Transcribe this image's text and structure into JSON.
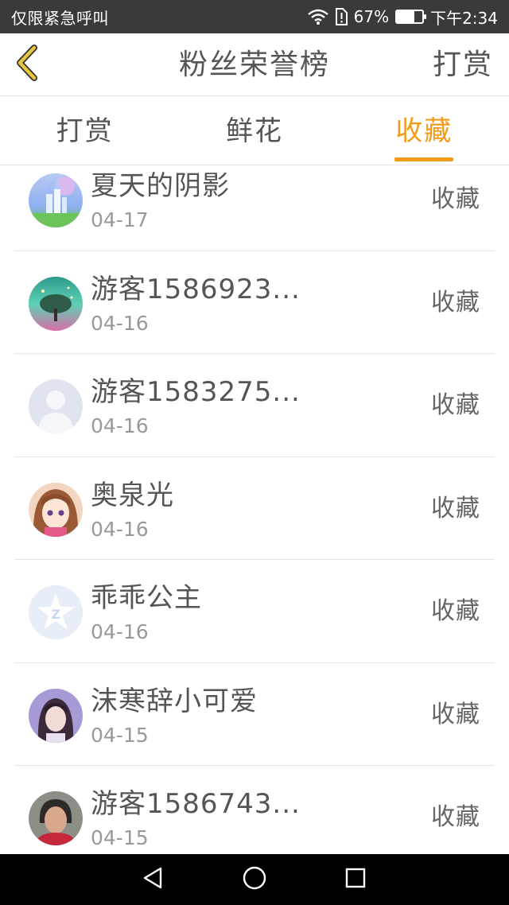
{
  "status_bar": {
    "carrier": "仅限紧急呼叫",
    "battery": "67%",
    "battery_level": 0.67,
    "time": "下午2:34"
  },
  "header": {
    "title": "粉丝荣誉榜",
    "action": "打赏"
  },
  "tabs": [
    {
      "label": "打赏",
      "active": false
    },
    {
      "label": "鲜花",
      "active": false
    },
    {
      "label": "收藏",
      "active": true
    }
  ],
  "list": [
    {
      "name": "夏天的阴影",
      "date": "04-17",
      "action": "收藏",
      "avatar": "castle-avatar"
    },
    {
      "name": "游客1586923...",
      "date": "04-16",
      "action": "收藏",
      "avatar": "tree-avatar"
    },
    {
      "name": "游客1583275...",
      "date": "04-16",
      "action": "收藏",
      "avatar": "default-user-avatar"
    },
    {
      "name": "奥泉光",
      "date": "04-16",
      "action": "收藏",
      "avatar": "anime-girl-avatar"
    },
    {
      "name": "乖乖公主",
      "date": "04-16",
      "action": "收藏",
      "avatar": "qzone-star-avatar"
    },
    {
      "name": "沫寒辞小可爱",
      "date": "04-15",
      "action": "收藏",
      "avatar": "girl-photo-avatar"
    },
    {
      "name": "游客1586743...",
      "date": "04-15",
      "action": "收藏",
      "avatar": "elder-photo-avatar"
    }
  ],
  "colors": {
    "accent": "#f19b18",
    "text": "#555555",
    "subtext": "#999999",
    "back_arrow": "#e7c53c"
  }
}
